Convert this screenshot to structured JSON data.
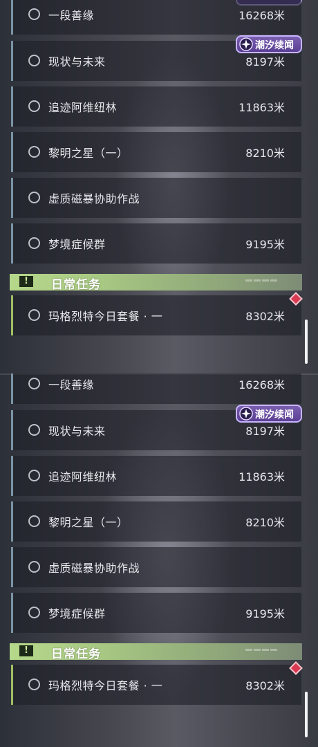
{
  "panels": [
    {
      "quests": [
        {
          "title": "一段善缘",
          "distance": "16268米"
        },
        {
          "title": "现状与未来",
          "distance": "8197米"
        },
        {
          "title": "追迹阿维纽林",
          "distance": "11863米"
        },
        {
          "title": "黎明之星（一）",
          "distance": "8210米"
        },
        {
          "title": "虚质磁暴协助作战",
          "distance": ""
        },
        {
          "title": "梦境症候群",
          "distance": "9195米"
        }
      ],
      "badge": {
        "label": "潮汐续闻",
        "icon": "tide-star-icon"
      },
      "daily_section": {
        "title": "日常任务",
        "icon": "exclamation-icon"
      },
      "daily_quest": {
        "title": "玛格烈特今日套餐 · 一",
        "distance": "8302米"
      }
    },
    {
      "quests": [
        {
          "title": "一段善缘",
          "distance": "16268米"
        },
        {
          "title": "现状与未来",
          "distance": "8197米"
        },
        {
          "title": "追迹阿维纽林",
          "distance": "11863米"
        },
        {
          "title": "黎明之星（一）",
          "distance": "8210米"
        },
        {
          "title": "虚质磁暴协助作战",
          "distance": ""
        },
        {
          "title": "梦境症候群",
          "distance": "9195米"
        }
      ],
      "badge": {
        "label": "潮汐续闻",
        "icon": "tide-star-icon"
      },
      "daily_section": {
        "title": "日常任务",
        "icon": "exclamation-icon"
      },
      "daily_quest": {
        "title": "玛格烈特今日套餐 · 一",
        "distance": "8302米"
      }
    }
  ],
  "colors": {
    "main_quest_accent": "#7c93a6",
    "daily_accent": "#9fbf63",
    "badge_purple": "#5a3f94",
    "alert_red": "#d93a52"
  }
}
